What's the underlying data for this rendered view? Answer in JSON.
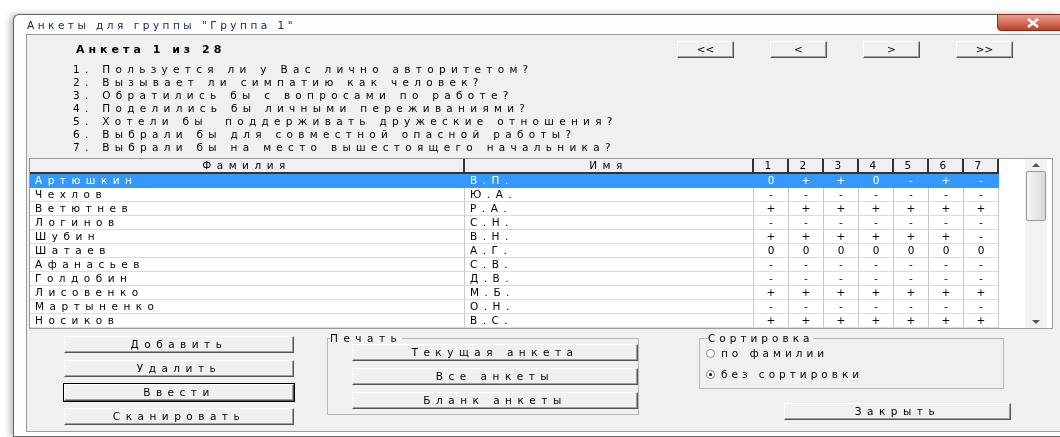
{
  "window": {
    "title": "Анкеты для группы \"Группа 1\""
  },
  "header": "Анкета 1 из 28",
  "nav_buttons": [
    "<<",
    "<",
    ">",
    ">>"
  ],
  "questions": [
    "1. Пользуется ли у Вас лично авторитетом?",
    "2. Вызывает ли симпатию как человек?",
    "3. Обратились бы с вопросами по работе?",
    "4. Поделились бы личными переживаниями?",
    "5. Хотели бы  поддерживать дружеские отношения?",
    "6. Выбрали бы для совместной опасной работы?",
    "7. Выбрали бы на место вышестоящего начальника?"
  ],
  "table": {
    "columns": [
      "Фамилия",
      "Имя",
      "1",
      "2",
      "3",
      "4",
      "5",
      "6",
      "7"
    ],
    "rows": [
      {
        "surname": "Артюшкин",
        "name": "В.П.",
        "answers": [
          "0",
          "+",
          "+",
          "0",
          "-",
          "+",
          "-"
        ],
        "selected": true
      },
      {
        "surname": "Чехлов",
        "name": "Ю.А.",
        "answers": [
          "-",
          "-",
          "-",
          "-",
          "-",
          "-",
          "-"
        ],
        "selected": false
      },
      {
        "surname": "Ветютнев",
        "name": "Р.А.",
        "answers": [
          "+",
          "+",
          "+",
          "+",
          "+",
          "+",
          "+"
        ],
        "selected": false
      },
      {
        "surname": "Логинов",
        "name": "С.Н.",
        "answers": [
          "-",
          "-",
          "-",
          "-",
          "-",
          "-",
          "-"
        ],
        "selected": false
      },
      {
        "surname": "Шубин",
        "name": "В.Н.",
        "answers": [
          "+",
          "+",
          "+",
          "+",
          "+",
          "+",
          "-"
        ],
        "selected": false
      },
      {
        "surname": "Шатаев",
        "name": "А.Г.",
        "answers": [
          "0",
          "0",
          "0",
          "0",
          "0",
          "0",
          "0"
        ],
        "selected": false
      },
      {
        "surname": "Афанасьев",
        "name": "С.В.",
        "answers": [
          "-",
          "-",
          "-",
          "-",
          "-",
          "-",
          "-"
        ],
        "selected": false
      },
      {
        "surname": "Голдобин",
        "name": "Д.В.",
        "answers": [
          "-",
          "-",
          "-",
          "-",
          "-",
          "-",
          "-"
        ],
        "selected": false
      },
      {
        "surname": "Лисовенко",
        "name": "М.Б.",
        "answers": [
          "+",
          "+",
          "+",
          "+",
          "+",
          "+",
          "+"
        ],
        "selected": false
      },
      {
        "surname": "Мартыненко",
        "name": "О.Н.",
        "answers": [
          "-",
          "-",
          "-",
          "-",
          "-",
          "-",
          "-"
        ],
        "selected": false
      },
      {
        "surname": "Носиков",
        "name": "В.С.",
        "answers": [
          "+",
          "+",
          "+",
          "+",
          "+",
          "+",
          "+"
        ],
        "selected": false
      }
    ]
  },
  "actions": [
    {
      "label": "Добавить",
      "focused": false
    },
    {
      "label": "Удалить",
      "focused": false
    },
    {
      "label": "Ввести",
      "focused": true
    },
    {
      "label": "Сканировать",
      "focused": false
    }
  ],
  "print": {
    "title": "Печать",
    "buttons": [
      "Текущая анкета",
      "Все анкеты",
      "Бланк анкеты"
    ]
  },
  "sorting": {
    "title": "Сортировка",
    "options": [
      {
        "label": "по фамилии",
        "selected": false
      },
      {
        "label": "без сортировки",
        "selected": true
      }
    ]
  },
  "close_button": "Закрыть"
}
